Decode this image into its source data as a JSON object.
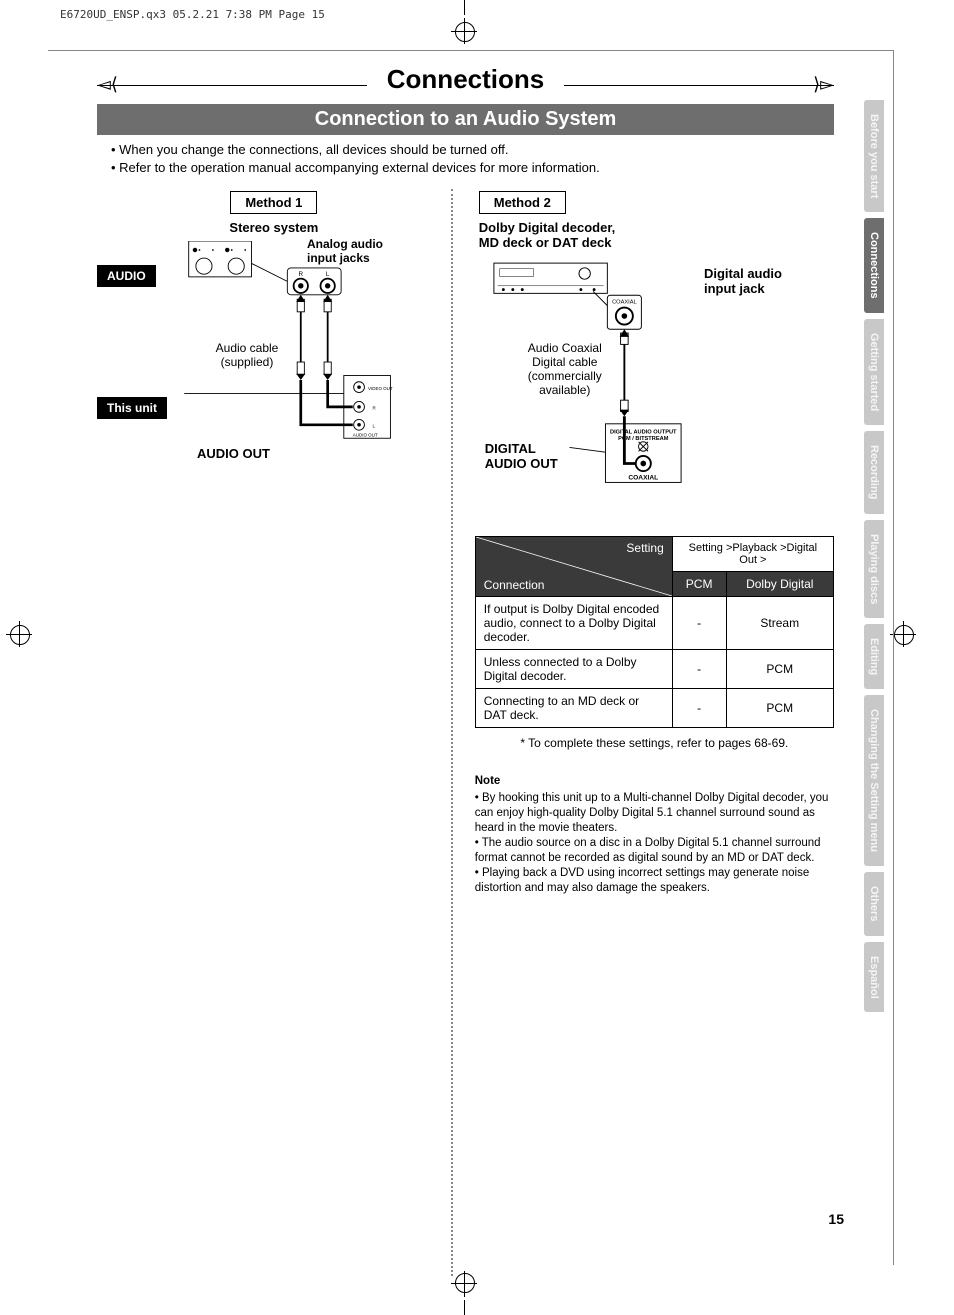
{
  "header_meta": "E6720UD_ENSP.qx3  05.2.21 7:38 PM  Page 15",
  "page_title": "Connections",
  "section_heading": "Connection to an Audio System",
  "intro": [
    "• When you change the connections, all devices should be turned off.",
    "• Refer to the operation manual accompanying external devices for more information."
  ],
  "method1": {
    "title": "Method 1",
    "subtitle": "Stereo system",
    "audio_label": "AUDIO",
    "analog_label_1": "Analog audio",
    "analog_label_2": "input jacks",
    "cable_label_1": "Audio cable",
    "cable_label_2": "(supplied)",
    "this_unit_label": "This unit",
    "audio_out_label": "AUDIO OUT",
    "video_out": "VIDEO OUT",
    "audio_out_small": "AUDIO OUT",
    "r_label": "R",
    "l_label": "L"
  },
  "method2": {
    "title": "Method 2",
    "subtitle_1": "Dolby Digital decoder,",
    "subtitle_2": "MD deck or DAT deck",
    "digital_label_1": "Digital audio",
    "digital_label_2": "input jack",
    "coaxial_label": "COAXIAL",
    "cable_label_1": "Audio Coaxial",
    "cable_label_2": "Digital cable",
    "cable_label_3": "(commercially",
    "cable_label_4": "available)",
    "digital_out_1": "DIGITAL",
    "digital_out_2": "AUDIO OUT",
    "jack_label_1": "DIGITAL AUDIO OUTPUT",
    "jack_label_2": "PCM / BITSTREAM",
    "jack_label_3": "COAXIAL"
  },
  "table": {
    "setting_hdr": "Setting",
    "path_hdr": "Setting >Playback >Digital Out >",
    "connection_hdr": "Connection",
    "col_pcm": "PCM",
    "col_dolby": "Dolby Digital",
    "rows": [
      {
        "c": "If output is Dolby Digital encoded audio, connect to a Dolby Digital decoder.",
        "pcm": "-",
        "dd": "Stream"
      },
      {
        "c": "Unless connected to a Dolby Digital decoder.",
        "pcm": "-",
        "dd": "PCM"
      },
      {
        "c": "Connecting to an MD deck or DAT deck.",
        "pcm": "-",
        "dd": "PCM"
      }
    ]
  },
  "footnote": "* To complete these settings, refer to pages 68-69.",
  "note": {
    "title": "Note",
    "bullets": [
      "• By hooking this unit up to a Multi-channel Dolby Digital decoder, you can enjoy high-quality Dolby Digital 5.1 channel surround sound as heard in the movie theaters.",
      "• The audio source on a disc in a Dolby Digital 5.1 channel surround format cannot be recorded as digital sound by an MD or DAT deck.",
      "• Playing back a DVD using incorrect settings may generate noise distortion and may also damage the speakers."
    ]
  },
  "side_tabs": [
    {
      "label": "Before you start",
      "active": false
    },
    {
      "label": "Connections",
      "active": true
    },
    {
      "label": "Getting started",
      "active": false
    },
    {
      "label": "Recording",
      "active": false
    },
    {
      "label": "Playing discs",
      "active": false
    },
    {
      "label": "Editing",
      "active": false
    },
    {
      "label": "Changing the Setting menu",
      "active": false
    },
    {
      "label": "Others",
      "active": false
    },
    {
      "label": "Español",
      "active": false
    }
  ],
  "page_number": "15"
}
